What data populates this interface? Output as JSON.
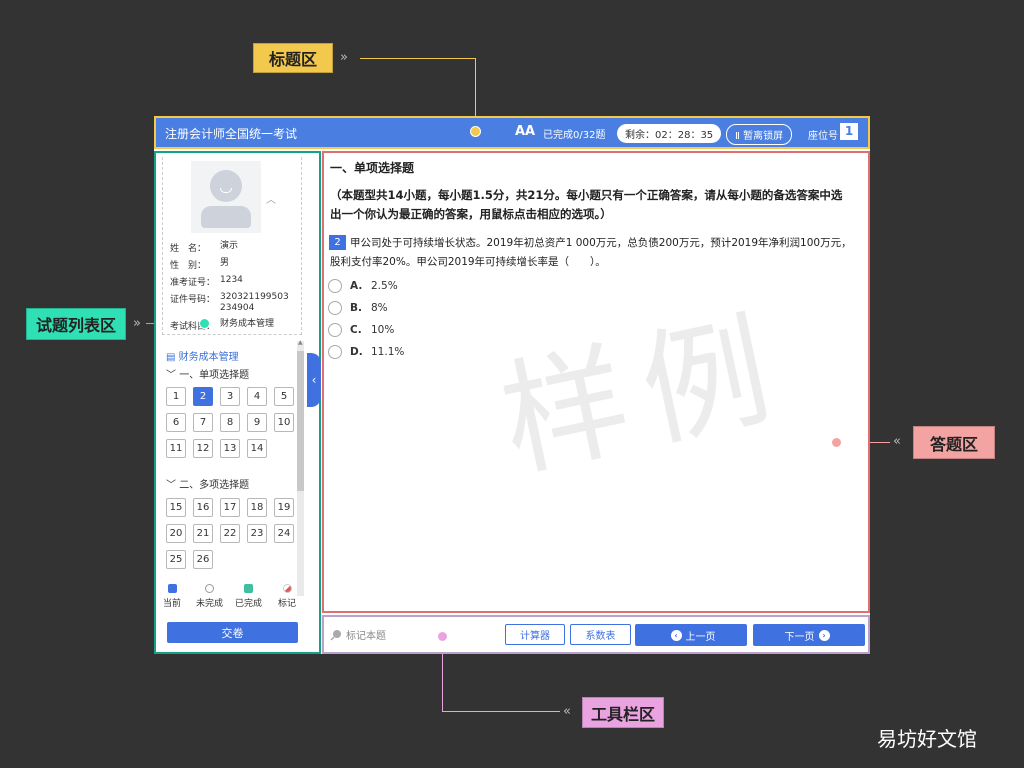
{
  "callouts": {
    "title_area": "标题区",
    "question_list_area": "试题列表区",
    "answer_area": "答题区",
    "toolbar_area": "工具栏区"
  },
  "titlebar": {
    "exam_title": "注册会计师全国统一考试",
    "font_icon": "AA",
    "completed": "已完成0/32题",
    "timer": "剩余：02：28：35",
    "pause": "Ⅱ 暂离锁屏",
    "seat_label": "座位号",
    "seat_number": "1"
  },
  "candidate": {
    "rows": [
      {
        "k": "姓　名：",
        "v": "演示"
      },
      {
        "k": "性　别：",
        "v": "男"
      },
      {
        "k": "准考证号：",
        "v": "1234"
      },
      {
        "k": "证件号码：",
        "v": "320321199503234904"
      },
      {
        "k": "考试科目：",
        "v": "财务成本管理"
      }
    ]
  },
  "question_list": {
    "subject": "财务成本管理",
    "sections": [
      {
        "title": "一、单项选择题",
        "questions": [
          "1",
          "2",
          "3",
          "4",
          "5",
          "6",
          "7",
          "8",
          "9",
          "10",
          "11",
          "12",
          "13",
          "14"
        ],
        "current": "2"
      },
      {
        "title": "二、多项选择题",
        "questions": [
          "15",
          "16",
          "17",
          "18",
          "19",
          "20",
          "21",
          "22",
          "23",
          "24",
          "25",
          "26"
        ]
      }
    ],
    "legend": [
      "当前",
      "未完成",
      "已完成",
      "标记"
    ],
    "legend_colors": [
      "#3f72e0",
      "#ffffff",
      "#3fbf9f",
      "#e05a5a"
    ],
    "submit": "交卷"
  },
  "answer": {
    "section_heading": "一、单项选择题",
    "section_desc": "（本题型共14小题，每小题1.5分，共21分。每小题只有一个正确答案，请从每小题的备选答案中选出一个你认为最正确的答案，用鼠标点击相应的选项。）",
    "question_number": "2",
    "question_text": "甲公司处于可持续增长状态。2019年初总资产1 000万元，总负债200万元，预计2019年净利润100万元，股利支付率20%。甲公司2019年可持续增长率是（　　）。",
    "options": [
      {
        "letter": "A.",
        "text": "2.5%"
      },
      {
        "letter": "B.",
        "text": "8%"
      },
      {
        "letter": "C.",
        "text": "10%"
      },
      {
        "letter": "D.",
        "text": "11.1%"
      }
    ],
    "watermark": "样例"
  },
  "toolbar": {
    "mark_question": "标记本题",
    "calculator": "计算器",
    "coefficient_table": "系数表",
    "prev": "上一页",
    "next": "下一页"
  },
  "brand": "易坊好文馆"
}
